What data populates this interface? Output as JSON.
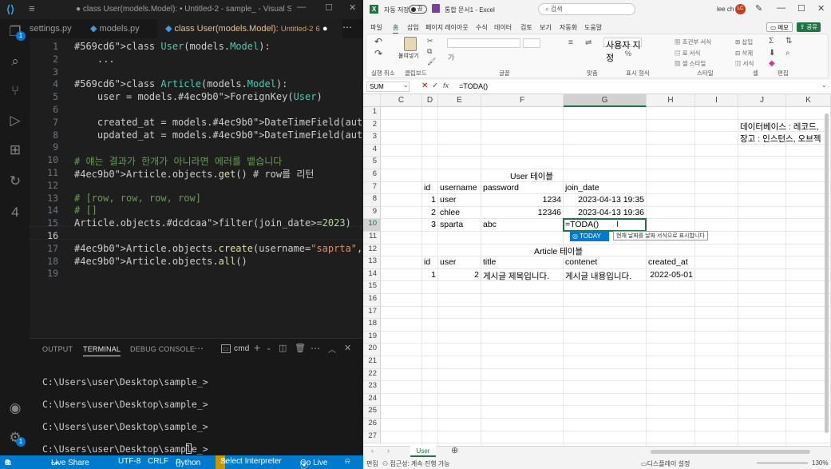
{
  "vscode": {
    "window_title": "● class User(models.Model): • Untitled-2 - sample_ - Visual St...",
    "tabs": [
      {
        "label": "settings.py"
      },
      {
        "label": "models.py"
      },
      {
        "label": "class User(models.Model):",
        "suffix": "Untitled-2",
        "badge": "6"
      }
    ],
    "code_lines": [
      {
        "n": "1",
        "text": "class User(models.Model):"
      },
      {
        "n": "2",
        "text": "    ..."
      },
      {
        "n": "3",
        "text": ""
      },
      {
        "n": "4",
        "text": "class Article(models.Model):"
      },
      {
        "n": "5",
        "text": "    user = models.ForeignKey(User)"
      },
      {
        "n": "6",
        "text": ""
      },
      {
        "n": "7",
        "text": "    created_at = models.DateTimeField(auto_now_add=True)"
      },
      {
        "n": "8",
        "text": "    updated_at = models.DateTimeField(auto_now=True)"
      },
      {
        "n": "9",
        "text": ""
      },
      {
        "n": "10",
        "text": "# 얘는 결과가 한개가 아니라면 에러를 뱉습니다"
      },
      {
        "n": "11",
        "text": "Article.objects.get() # row를 리턴"
      },
      {
        "n": "12",
        "text": ""
      },
      {
        "n": "13",
        "text": "# [row, row, row, row]"
      },
      {
        "n": "14",
        "text": "# []"
      },
      {
        "n": "15",
        "text": "Article.objects.filter(join_date>=2023)"
      },
      {
        "n": "16",
        "text": ""
      },
      {
        "n": "17",
        "text": "Article.objects.create(username=\"saprta\", password=\"abc\""
      },
      {
        "n": "18",
        "text": "Article.objects.all()"
      },
      {
        "n": "19",
        "text": ""
      }
    ],
    "panel_tabs": {
      "output": "OUTPUT",
      "terminal": "TERMINAL",
      "debug": "DEBUG CONSOLE",
      "shell": "cmd"
    },
    "terminal_lines": [
      "C:\\Users\\user\\Desktop\\sample_>",
      "C:\\Users\\user\\Desktop\\sample_>",
      "C:\\Users\\user\\Desktop\\sample_>",
      "C:\\Users\\user\\Desktop\\sample_>"
    ],
    "status": {
      "errors": "0",
      "warnings": "6",
      "live_share": "Live Share",
      "encoding": "UTF-8",
      "eol": "CRLF",
      "language": "Python",
      "interpreter": "Select Interpreter",
      "go_live": "Go Live"
    }
  },
  "excel": {
    "autosave_label": "자동 저장",
    "autosave_state": "끔",
    "doc_title": "통합 문서1 - Excel",
    "search_placeholder": "검색",
    "user_name": "lee ch",
    "user_initials": "LC",
    "menu": [
      "파일",
      "홈",
      "삽입",
      "페이지 레이아웃",
      "수식",
      "데이터",
      "검토",
      "보기",
      "자동화",
      "도움말"
    ],
    "memo_label": "메모",
    "share_label": "공유",
    "ribbon_groups": [
      "실행 취소",
      "클립보드",
      "글꼴",
      "맞춤",
      "표시 형식",
      "스타일",
      "셀",
      "편집"
    ],
    "paste_label": "붙여넣기",
    "ribbon_small": [
      "사용자 지정",
      "조건부 서식",
      "표 서식",
      "셀 스타일",
      "삽입",
      "삭제",
      "서식"
    ],
    "name_box": "SUM",
    "formula": "=TODA()",
    "columns": [
      "C",
      "D",
      "E",
      "F",
      "G",
      "H",
      "I",
      "J",
      "K"
    ],
    "rows": [
      "1",
      "2",
      "3",
      "4",
      "5",
      "6",
      "7",
      "8",
      "9",
      "10",
      "11",
      "12",
      "13",
      "14",
      "15",
      "16",
      "17",
      "18",
      "19",
      "20",
      "21",
      "22",
      "23",
      "24",
      "25",
      "26",
      "27"
    ],
    "cells": {
      "j2": "데이터베이스 : 레코드,",
      "j3": "장고 : 인스턴스, 오브젝",
      "user_table_title": "User 테이블",
      "user_headers": [
        "id",
        "username",
        "password",
        "join_date"
      ],
      "user_rows": [
        [
          "1",
          "user",
          "1234",
          "2023-04-13 19:35"
        ],
        [
          "2",
          "chlee",
          "12346",
          "2023-04-13 19:36"
        ],
        [
          "3",
          "sparta",
          "abc",
          "=TODA()"
        ]
      ],
      "article_table_title": "Article 테이블",
      "article_headers": [
        "id",
        "user",
        "title",
        "contenet",
        "created_at"
      ],
      "article_rows": [
        [
          "1",
          "2",
          "게시글 제목입니다.",
          "게시글 내용입니다.",
          "2022-05-01"
        ]
      ]
    },
    "autocomplete": {
      "item": "TODAY",
      "tooltip": "현재 날짜를 날짜 서식으로 표시합니다"
    },
    "sheet_tab": "User",
    "status_left": "편집",
    "status_accessibility": "접근성: 계속 진행 가능",
    "status_display": "디스플레이 설정",
    "zoom": "130%",
    "colors": {
      "excel_green": "#217346",
      "vscode_blue": "#007acc",
      "accent": "#0f6cbd"
    }
  }
}
